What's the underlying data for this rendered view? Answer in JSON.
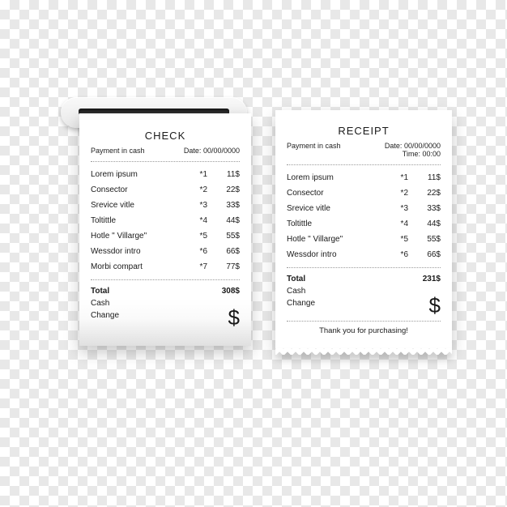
{
  "left": {
    "title": "CHECK",
    "payment_label": "Payment in cash",
    "date_label": "Date:",
    "date_value": "00/00/0000",
    "items": [
      {
        "name": "Lorem ipsum",
        "qty": "*1",
        "price": "11$"
      },
      {
        "name": "Consector",
        "qty": "*2",
        "price": "22$"
      },
      {
        "name": "Srevice vitle",
        "qty": "*3",
        "price": "33$"
      },
      {
        "name": "Toltittle",
        "qty": "*4",
        "price": "44$"
      },
      {
        "name": "Hotle \" Villarge\"",
        "qty": "*5",
        "price": "55$"
      },
      {
        "name": "Wessdor intro",
        "qty": "*6",
        "price": "66$"
      },
      {
        "name": "Morbi compart",
        "qty": "*7",
        "price": "77$"
      }
    ],
    "total_label": "Total",
    "total_value": "308$",
    "cash_label": "Cash",
    "change_label": "Change",
    "currency_symbol": "$"
  },
  "right": {
    "title": "RECEIPT",
    "payment_label": "Payment in cash",
    "date_label": "Date:",
    "date_value": "00/00/0000",
    "time_label": "Time:",
    "time_value": "00:00",
    "items": [
      {
        "name": "Lorem ipsum",
        "qty": "*1",
        "price": "11$"
      },
      {
        "name": "Consector",
        "qty": "*2",
        "price": "22$"
      },
      {
        "name": "Srevice vitle",
        "qty": "*3",
        "price": "33$"
      },
      {
        "name": "Toltittle",
        "qty": "*4",
        "price": "44$"
      },
      {
        "name": "Hotle \" Villarge\"",
        "qty": "*5",
        "price": "55$"
      },
      {
        "name": "Wessdor intro",
        "qty": "*6",
        "price": "66$"
      }
    ],
    "total_label": "Total",
    "total_value": "231$",
    "cash_label": "Cash",
    "change_label": "Change",
    "currency_symbol": "$",
    "thanks": "Thank you for purchasing!"
  }
}
